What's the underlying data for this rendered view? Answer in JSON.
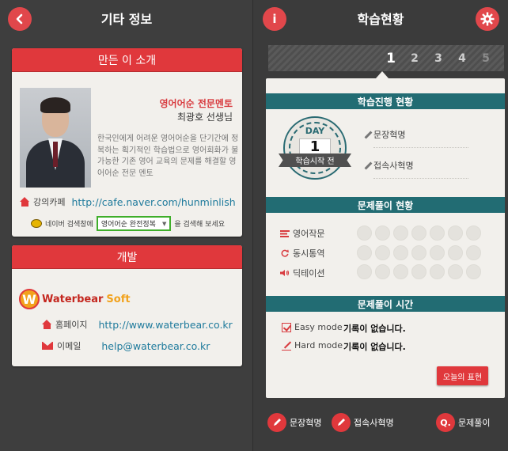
{
  "left": {
    "title": "기타 정보",
    "maker_card": {
      "header": "만든 이 소개",
      "role": "영어어순 전문멘토",
      "name": "최광호 선생님",
      "description": "한국인에게 어려운 영어어순을 단기간에 정복하는 획기적인 학습법으로 영어회화가 불가능한 기존 영어 교육의 문제를 해결할 영어어순 전문 멘토",
      "cafe_label": "강의카페",
      "cafe_url": "http://cafe.naver.com/hunminlish",
      "naver_prefix": "네이버 검색창에",
      "naver_query": "영어어순 완전정복",
      "naver_suffix": "을 검색해 보세요"
    },
    "dev_card": {
      "header": "개발",
      "logo_main": "Waterbear",
      "logo_sub": "Soft",
      "logo_letter": "W",
      "homepage_label": "홈페이지",
      "homepage_url": "http://www.waterbear.co.kr",
      "email_label": "이메일",
      "email": "help@waterbear.co.kr"
    }
  },
  "right": {
    "title": "학습현황",
    "info_glyph": "i",
    "days": [
      "1",
      "2",
      "3",
      "4",
      "5"
    ],
    "active_day": "1",
    "progress_header": "학습진행 현황",
    "badge_day_label": "DAY",
    "badge_day_value": "1",
    "badge_ribbon": "학습시작 전",
    "stat1": "문장혁명",
    "stat2": "접속사혁명",
    "problem_header": "문제풀이 현황",
    "problems": [
      {
        "label": "영어작문",
        "count": 7
      },
      {
        "label": "동시통역",
        "count": 7
      },
      {
        "label": "딕테이션",
        "count": 7
      }
    ],
    "time_header": "문제풀이 시간",
    "easy_label": "Easy mode",
    "easy_value": "기록이 없습니다.",
    "hard_label": "Hard mode",
    "hard_value": "기록이 없습니다.",
    "today_button": "오늘의 표현",
    "nav": {
      "sentence": "문장혁명",
      "conj": "접속사혁명",
      "quiz": "문제풀이",
      "quiz_glyph": "Q."
    }
  },
  "colors": {
    "accent_red": "#e0383c",
    "teal": "#226c73",
    "panel_bg": "#f2f0ec",
    "link": "#1e7a9c"
  }
}
